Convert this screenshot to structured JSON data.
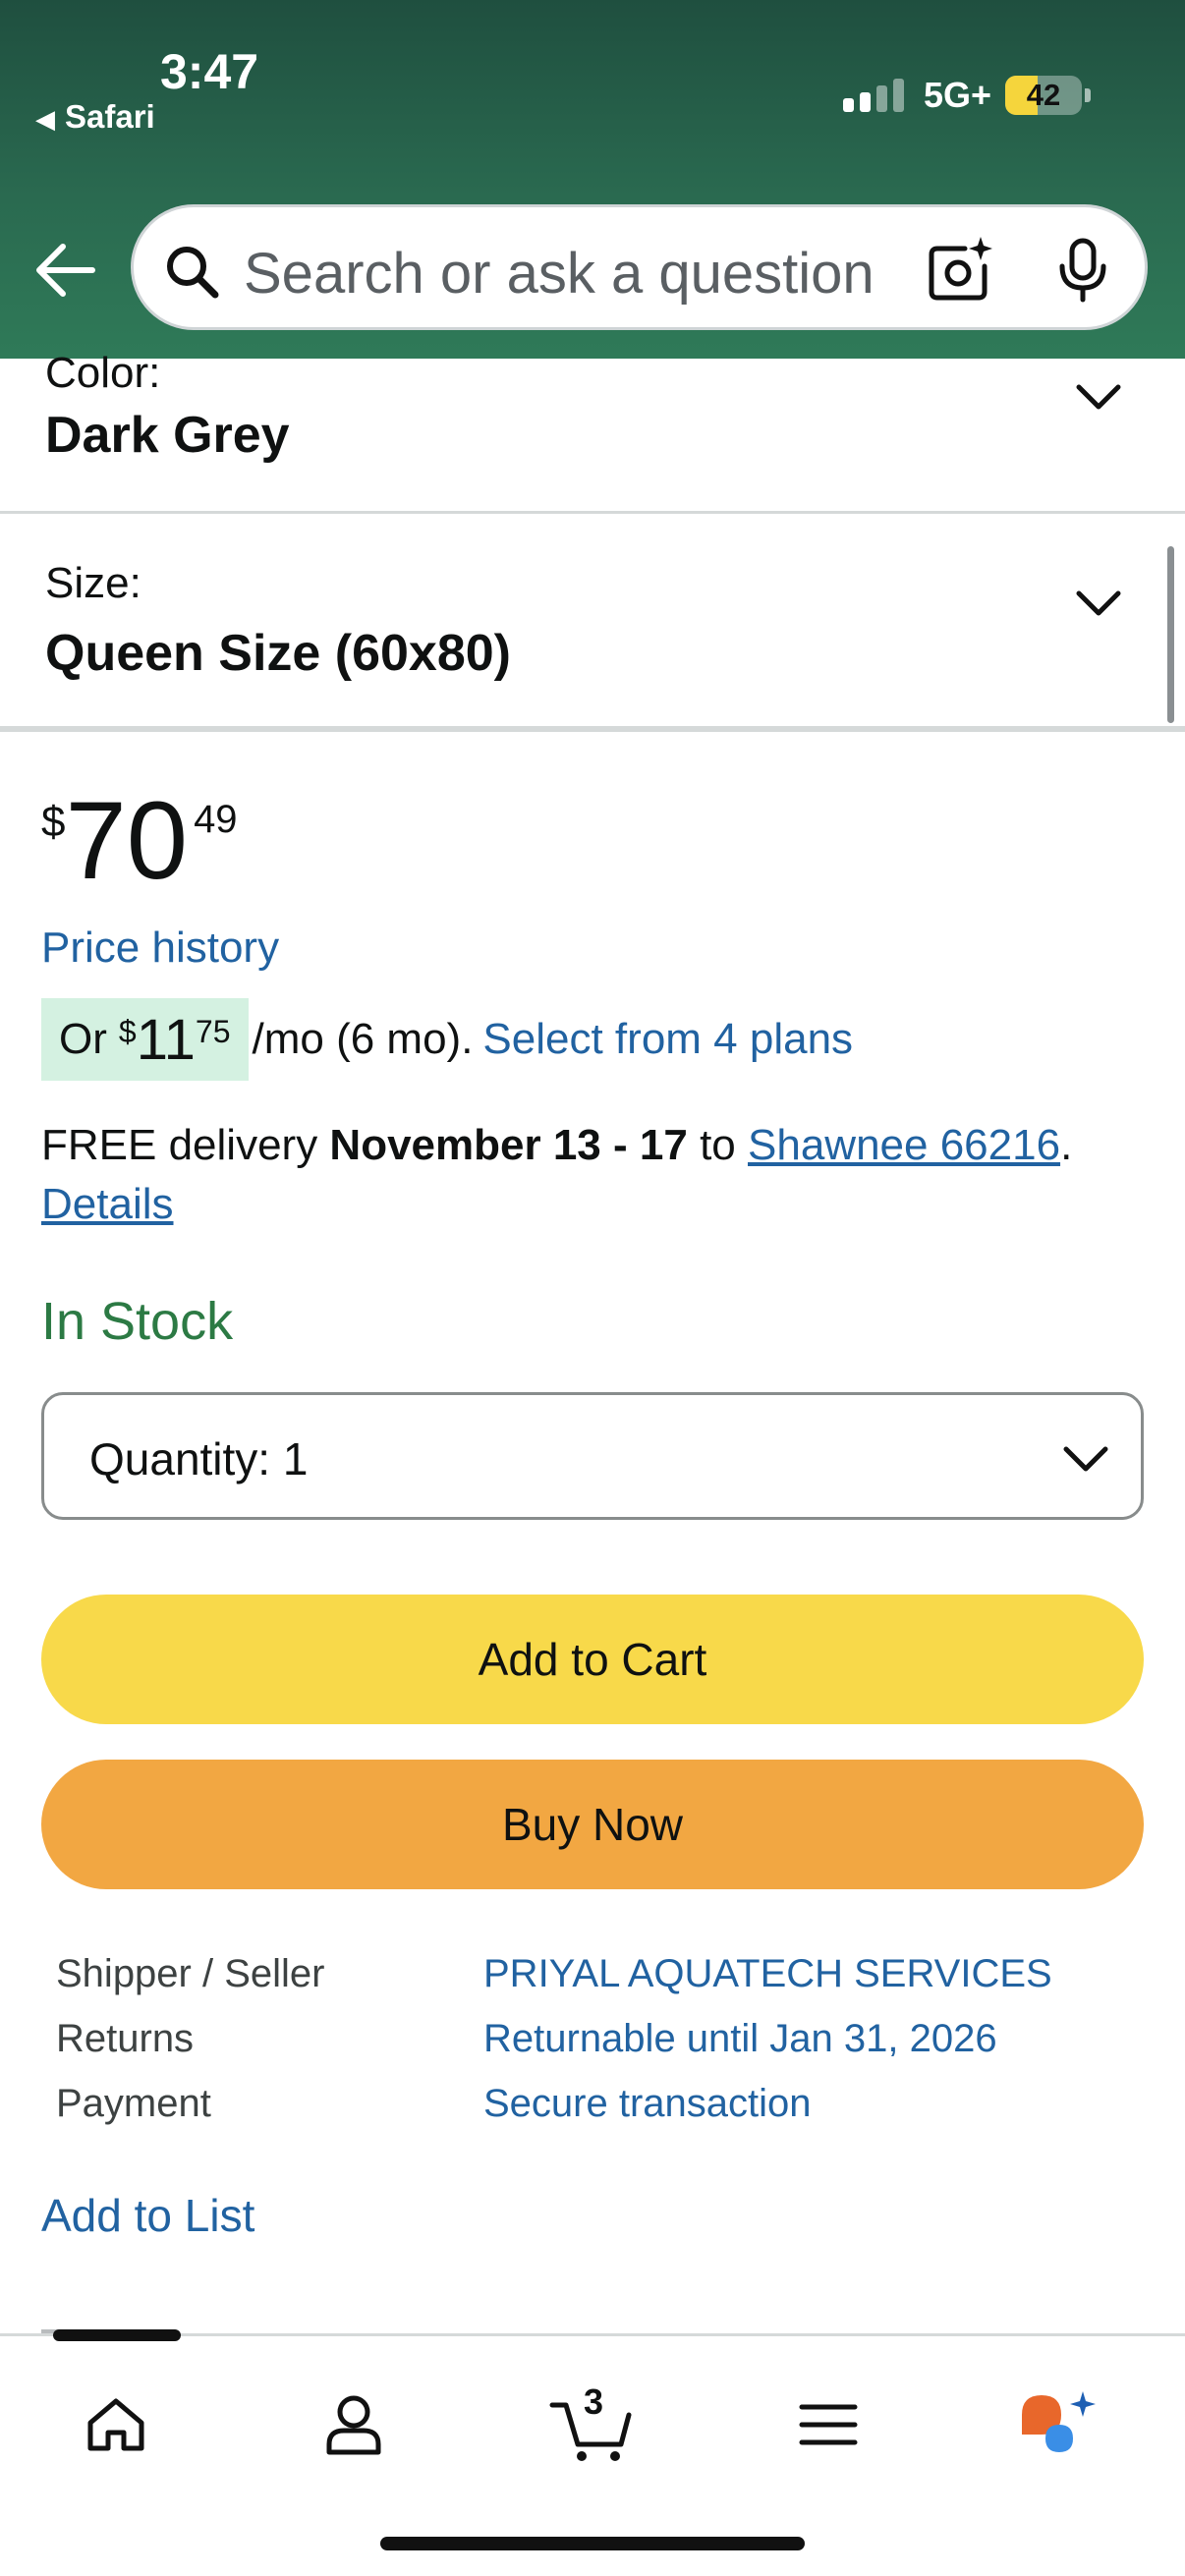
{
  "status_bar": {
    "time": "3:47",
    "back_app": "Safari",
    "network": "5G+",
    "battery": "42",
    "battery_level_percent": 42
  },
  "search": {
    "placeholder": "Search or ask a question"
  },
  "selectors": {
    "color_label": "Color:",
    "color_value": "Dark Grey",
    "size_label": "Size:",
    "size_value": "Queen Size (60x80)"
  },
  "price": {
    "symbol": "$",
    "whole": "70",
    "fraction": "49",
    "history_link": "Price history"
  },
  "installment": {
    "prefix": "Or",
    "symbol": "$",
    "whole": "11",
    "cents": "75",
    "suffix": "/mo (6 mo).",
    "plans_link": "Select from 4 plans"
  },
  "delivery": {
    "prefix": "FREE delivery",
    "dates": "November 13 - 17",
    "to": "to",
    "location": "Shawnee 66216",
    "period": ".",
    "details_link": "Details"
  },
  "stock": "In Stock",
  "quantity": {
    "label": "Quantity:",
    "value": "1"
  },
  "buttons": {
    "add_to_cart": "Add to Cart",
    "buy_now": "Buy Now"
  },
  "info_rows": [
    {
      "key": "Shipper / Seller",
      "value": "PRIYAL AQUATECH SERVICES"
    },
    {
      "key": "Returns",
      "value": "Returnable until Jan 31, 2026"
    },
    {
      "key": "Payment",
      "value": "Secure transaction"
    }
  ],
  "add_to_list": "Add to List",
  "nav": {
    "cart_count": "3",
    "items": [
      "home-icon",
      "account-icon",
      "cart-icon",
      "menu-icon",
      "rufus-icon"
    ]
  },
  "colors": {
    "header_green": "#2a6a50",
    "link_blue": "#2162a1",
    "in_stock_green": "#2c7a44",
    "add_to_cart_yellow": "#f8d94a",
    "buy_now_orange": "#f2a742",
    "installment_bg": "#d4f1e1"
  }
}
